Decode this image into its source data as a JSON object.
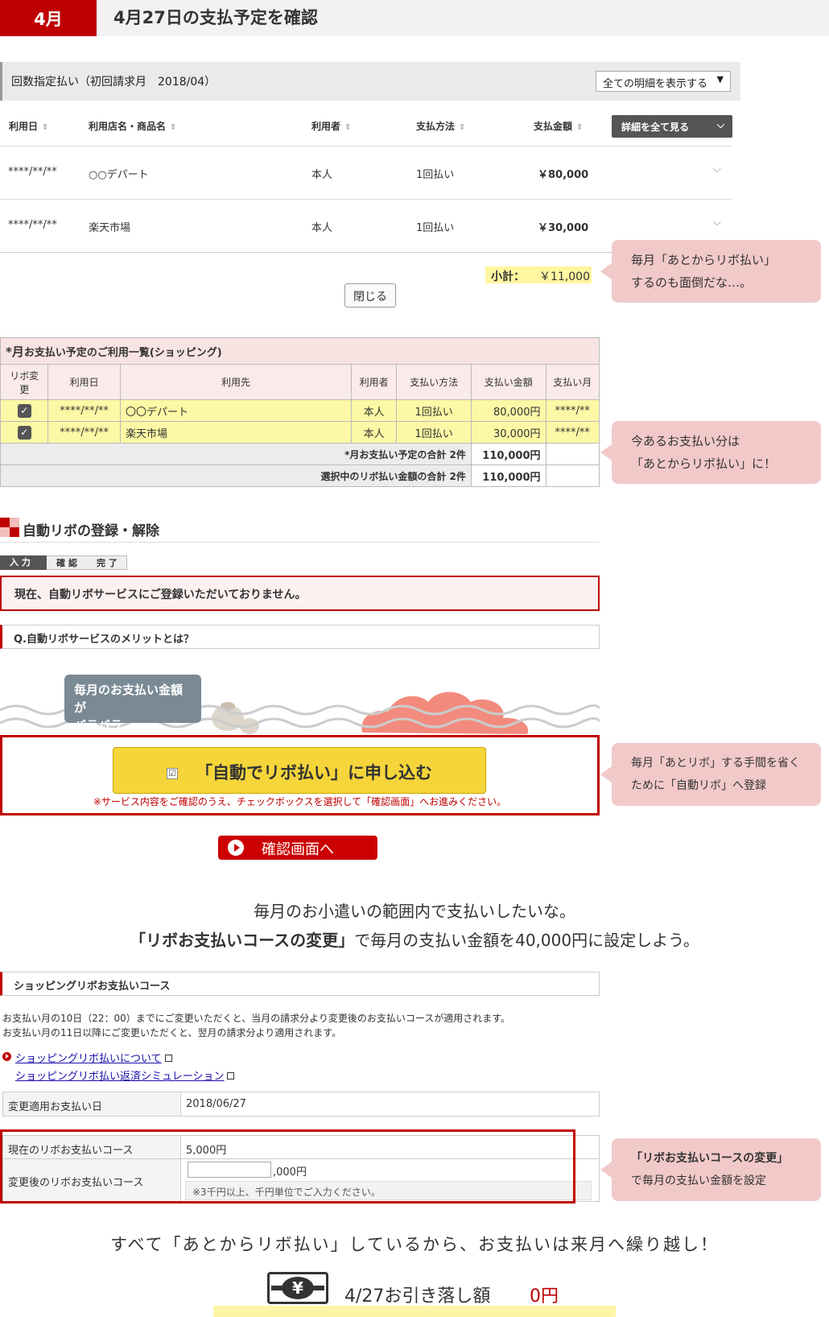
{
  "header": {
    "month": "4月",
    "title": "4月27日の支払予定を確認"
  },
  "section1": {
    "title": "回数指定払い（初回請求月　2018/04）",
    "filter_select": "全ての明細を表示する",
    "columns": [
      "利用日",
      "利用店名・商品名",
      "利用者",
      "支払方法",
      "支払金額"
    ],
    "detail_button": "詳細を全て見る",
    "rows": [
      {
        "date": "****/**/**",
        "store": "○○デパート",
        "user": "本人",
        "method": "1回払い",
        "amount": "￥80,000"
      },
      {
        "date": "****/**/**",
        "store": "楽天市場",
        "user": "本人",
        "method": "1回払い",
        "amount": "￥30,000"
      }
    ],
    "subtotal_label": "小計：",
    "subtotal_value": "￥11,000",
    "close_button": "閉じる"
  },
  "bubbles": {
    "b1_line1": "毎月「あとからリボ払い」",
    "b1_line2": "するのも面倒だな…。",
    "b2_line1": "今あるお支払い分は",
    "b2_line2": "「あとからリボ払い」に！",
    "b3_line1": "毎月「あとリボ」する手間を省く",
    "b3_line2": "ために「自動リボ」へ登録",
    "b4_line1": "「リボお支払いコースの変更」",
    "b4_line2": "で毎月の支払い金額を設定"
  },
  "section2": {
    "title_big": "*月",
    "title_rest": "お支払い予定のご利用一覧(ショッピング)",
    "headers": [
      "リボ変更",
      "利用日",
      "利用先",
      "利用者",
      "支払い方法",
      "支払い金額",
      "支払い月"
    ],
    "rows": [
      {
        "date": "****/**/**",
        "store": "〇〇デパート",
        "user": "本人",
        "method": "1回払い",
        "amount": "80,000円",
        "month": "****/**"
      },
      {
        "date": "****/**/**",
        "store": "楽天市場",
        "user": "本人",
        "method": "1回払い",
        "amount": "30,000円",
        "month": "****/**"
      }
    ],
    "sum1_label": "*月お支払い予定の合計 2件",
    "sum1_value": "110,000円",
    "sum2_label": "選択中のリボ払い金額の合計 2件",
    "sum2_value": "110,000円"
  },
  "section3": {
    "title": "自動リボの登録・解除",
    "steps": [
      "入 力",
      "確 認",
      "完 了"
    ],
    "notice": "現在、自動リボサービスにご登録いただいておりません。",
    "question": "Q.自動リボサービスのメリットとは？",
    "illustration_line1": "毎月のお支払い金額が",
    "illustration_line2": "バラバラ…",
    "apply_button": "「自動でリボ払い」に申し込む",
    "apply_note": "※サービス内容をご確認のうえ、チェックボックスを選択して「確認画面」へお進みください。",
    "confirm_button": "確認画面へ"
  },
  "narrative": {
    "line1": "毎月のお小遣いの範囲内で支払いしたいな。",
    "line2_bold": "「リボお支払いコースの変更」",
    "line2_rest": "で毎月の支払い金額を40,000円に設定しよう。"
  },
  "course": {
    "title": "ショッピングリボお支払いコース",
    "desc1": "お支払い月の10日（22：00）までにご変更いただくと、当月の請求分より変更後のお支払いコースが適用されます。",
    "desc2": "お支払い月の11日以降にご変更いただくと、翌月の請求分より適用されます。",
    "link1": "ショッピングリボ払いについて",
    "link2": "ショッピングリボ払い返済シミュレーション",
    "apply_date_label": "変更適用お支払い日",
    "apply_date_value": "2018/06/27",
    "current_label": "現在のリボお支払いコース",
    "current_value": "5,000円",
    "new_label": "変更後のリボお支払いコース",
    "new_suffix": ",000円",
    "new_note": "※3千円以上、千円単位でご入力ください。"
  },
  "footer": {
    "text": "すべて「あとからリボ払い」しているから、お支払いは来月へ繰り越し！",
    "yen_symbol": "¥",
    "withdraw_label": "4/27お引き落し額",
    "withdraw_value": "0円"
  },
  "colors": {
    "brand_red": "#bf0000",
    "highlight_yellow": "#fcf8a5",
    "bubble_pink": "#f2c9c9",
    "button_yellow": "#f5d53a"
  }
}
